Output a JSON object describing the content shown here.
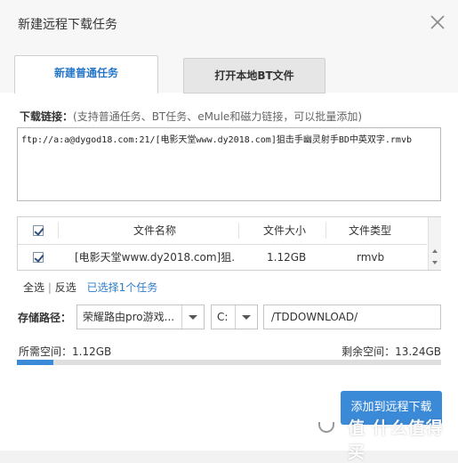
{
  "window": {
    "title": "新建远程下载任务",
    "close_icon": "close-icon"
  },
  "tabs": [
    {
      "label": "新建普通任务",
      "active": true
    },
    {
      "label": "打开本地BT文件",
      "active": false
    }
  ],
  "link_section": {
    "label": "下载链接：",
    "hint": "(支持普通任务、BT任务、eMule和磁力链接，可以批量添加)",
    "value": "ftp://a:a@dygod18.com:21/[电影天堂www.dy2018.com]狙击手幽灵射手BD中英双字.rmvb"
  },
  "file_table": {
    "columns": [
      "文件名称",
      "文件大小",
      "文件类型"
    ],
    "header_checked": true,
    "rows": [
      {
        "checked": true,
        "name": "[电影天堂www.dy2018.com]狙...",
        "size": "1.12GB",
        "type": "rmvb"
      }
    ]
  },
  "selection": {
    "select_all": "全选",
    "divider": "|",
    "invert": "反选",
    "status": "已选择1个任务"
  },
  "storage": {
    "label": "存储路径：",
    "device": "荣耀路由pro游戏...",
    "drive": "C:",
    "path": "/TDDOWNLOAD/"
  },
  "space": {
    "required": "所需空间：1.12GB",
    "remaining": "剩余空间：13.24GB",
    "used_fraction": 0.085
  },
  "actions": {
    "submit": "添加到远程下载"
  },
  "watermark": {
    "text": "值 什么值得买"
  },
  "colors": {
    "accent": "#3b8ad8",
    "tab_active_text": "#2677c9",
    "link_blue": "#2e7bc8"
  }
}
